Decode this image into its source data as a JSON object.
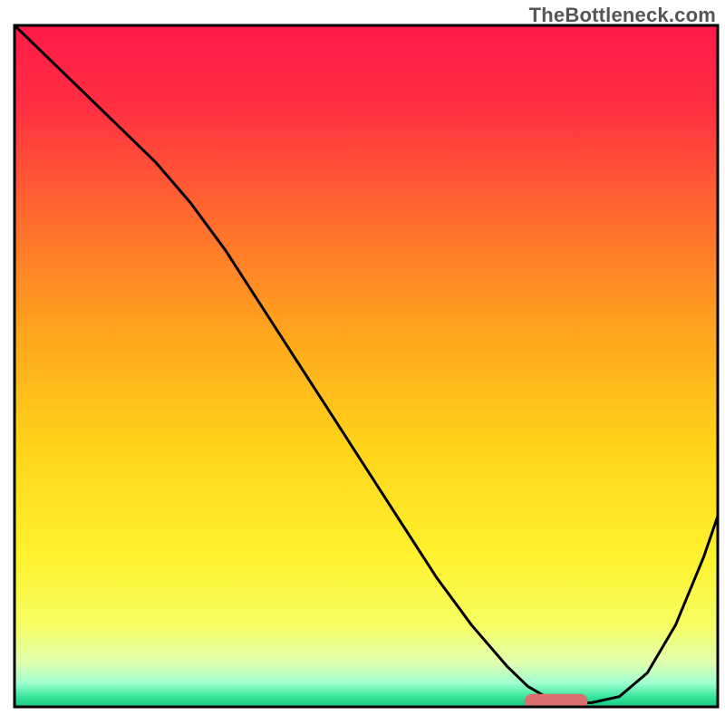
{
  "watermark": "TheBottleneck.com",
  "chart_data": {
    "type": "line",
    "title": "",
    "xlabel": "",
    "ylabel": "",
    "xlim": [
      0,
      100
    ],
    "ylim": [
      0,
      100
    ],
    "grid": false,
    "legend": false,
    "background_gradient_stops": [
      {
        "offset": 0.0,
        "color": "#ff1a49"
      },
      {
        "offset": 0.12,
        "color": "#ff2f42"
      },
      {
        "offset": 0.28,
        "color": "#ff6a2e"
      },
      {
        "offset": 0.45,
        "color": "#ffa51d"
      },
      {
        "offset": 0.62,
        "color": "#ffd41a"
      },
      {
        "offset": 0.78,
        "color": "#fff22e"
      },
      {
        "offset": 0.88,
        "color": "#f6ff63"
      },
      {
        "offset": 0.935,
        "color": "#e0ffb0"
      },
      {
        "offset": 0.965,
        "color": "#9fffcf"
      },
      {
        "offset": 0.985,
        "color": "#38e59c"
      },
      {
        "offset": 1.0,
        "color": "#18c77f"
      }
    ],
    "series": [
      {
        "name": "bottleneck-curve",
        "color": "#000000",
        "x": [
          0,
          5,
          10,
          15,
          20,
          25,
          30,
          35,
          40,
          45,
          50,
          55,
          60,
          65,
          70,
          73,
          76,
          78,
          82,
          86,
          90,
          94,
          98,
          100
        ],
        "y": [
          100,
          95,
          90,
          85,
          80,
          74,
          67,
          59,
          51,
          43,
          35,
          27,
          19,
          12,
          6,
          3,
          1.2,
          0.6,
          0.6,
          1.5,
          5,
          12,
          22,
          28
        ]
      }
    ],
    "marker": {
      "name": "optimal-range",
      "shape": "capsule",
      "color": "#d9706f",
      "x_center": 77,
      "y_center": 0.8,
      "width": 9,
      "height": 2.2
    },
    "axes": {
      "show_border": true,
      "border_color": "#000000",
      "inner_top_y": 3.5,
      "inner_left_x": 2.0,
      "inner_right_x": 99.0,
      "inner_bottom_y": 97.5
    }
  }
}
